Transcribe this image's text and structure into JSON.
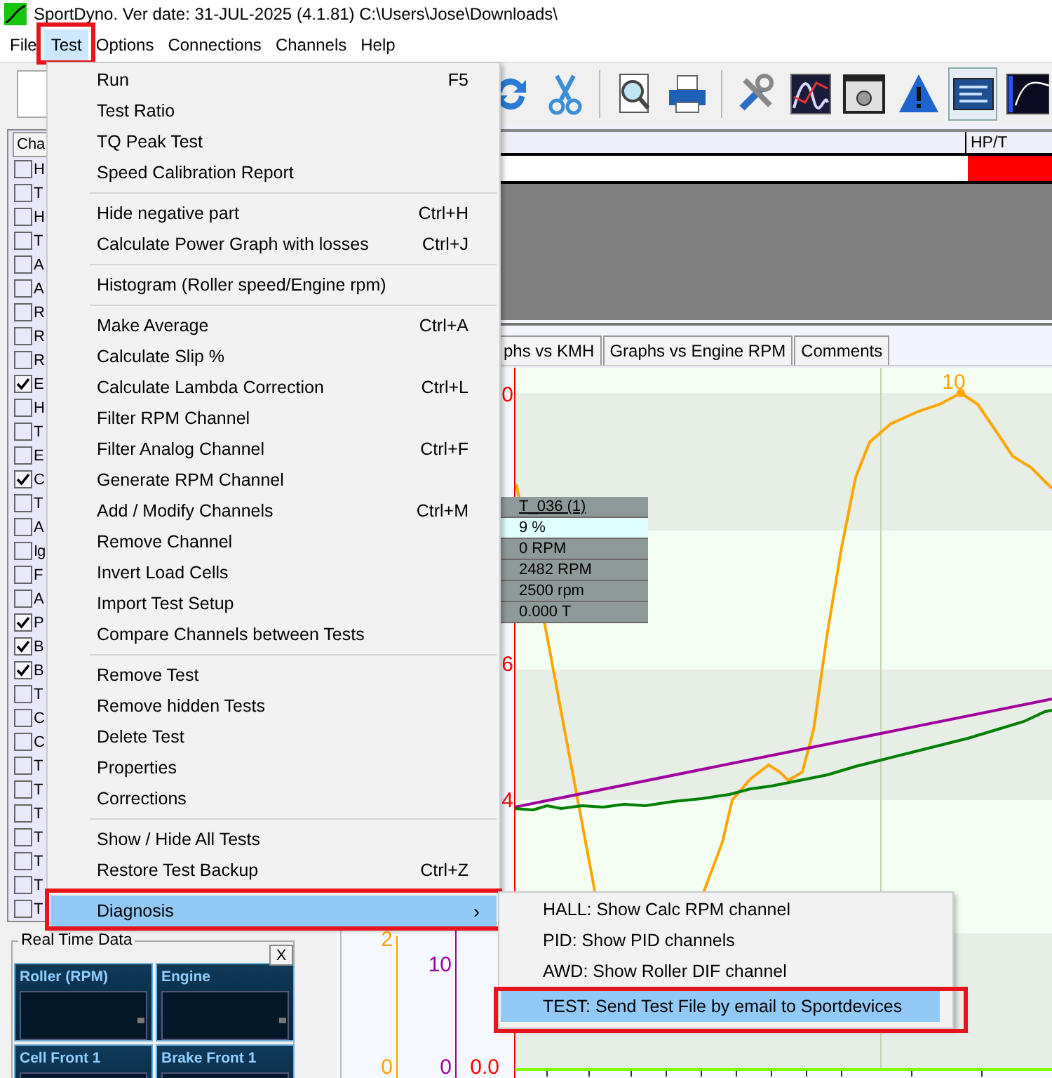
{
  "window": {
    "title": "SportDyno. Ver date: 31-JUL-2025 (4.1.81)  C:\\Users\\Jose\\Downloads\\"
  },
  "menubar": [
    {
      "label": "File",
      "selected": false,
      "highlighted": false
    },
    {
      "label": "Test",
      "selected": true,
      "highlighted": true
    },
    {
      "label": "Options",
      "selected": false,
      "highlighted": false
    },
    {
      "label": "Connections",
      "selected": false,
      "highlighted": false
    },
    {
      "label": "Channels",
      "selected": false,
      "highlighted": false
    },
    {
      "label": "Help",
      "selected": false,
      "highlighted": false
    }
  ],
  "toolbar_buttons": [
    {
      "pressed": false
    },
    {
      "pressed": false
    },
    {
      "pressed": false
    },
    {
      "pressed": false
    },
    {
      "pressed": false
    },
    {
      "pressed": false
    },
    {
      "pressed": false
    },
    {
      "pressed": false
    },
    {
      "pressed": true
    },
    {
      "pressed": false
    }
  ],
  "channel_list": {
    "header": "Cha",
    "rows": [
      {
        "label": "H",
        "checked": false
      },
      {
        "label": "T",
        "checked": false
      },
      {
        "label": "H",
        "checked": false
      },
      {
        "label": "T",
        "checked": false
      },
      {
        "label": "A",
        "checked": false
      },
      {
        "label": "A",
        "checked": false
      },
      {
        "label": "R",
        "checked": false
      },
      {
        "label": "R",
        "checked": false
      },
      {
        "label": "R",
        "checked": false
      },
      {
        "label": "E",
        "checked": true
      },
      {
        "label": "H",
        "checked": false
      },
      {
        "label": "T",
        "checked": false
      },
      {
        "label": "E",
        "checked": false
      },
      {
        "label": "C",
        "checked": true
      },
      {
        "label": "T",
        "checked": false
      },
      {
        "label": "A",
        "checked": false
      },
      {
        "label": "Ig",
        "checked": false
      },
      {
        "label": "F",
        "checked": false
      },
      {
        "label": "A",
        "checked": false
      },
      {
        "label": "P",
        "checked": true
      },
      {
        "label": "B",
        "checked": true
      },
      {
        "label": "B",
        "checked": true
      },
      {
        "label": "T",
        "checked": false
      },
      {
        "label": "C",
        "checked": false
      },
      {
        "label": "C",
        "checked": false
      },
      {
        "label": "T",
        "checked": false
      },
      {
        "label": "T",
        "checked": false
      },
      {
        "label": "T",
        "checked": false
      },
      {
        "label": "T",
        "checked": false
      },
      {
        "label": "T",
        "checked": false
      },
      {
        "label": "T",
        "checked": false
      },
      {
        "label": "T",
        "checked": false
      }
    ]
  },
  "real_time_data": {
    "title": "Real Time Data",
    "close": "X",
    "gauges": [
      {
        "label": "Roller (RPM)"
      },
      {
        "label": "Engine"
      },
      {
        "label": "Cell Front 1"
      },
      {
        "label": "Brake Front 1"
      }
    ]
  },
  "results_table": {
    "columns": [
      {
        "header": "HP/T",
        "color": "#ff0000"
      }
    ]
  },
  "tabs": [
    {
      "label": "phs vs KMH"
    },
    {
      "label": "Graphs vs Engine RPM"
    },
    {
      "label": "Comments"
    }
  ],
  "graph": {
    "axes": [
      {
        "color": "#ffa000",
        "labels": [
          "2",
          "0"
        ]
      },
      {
        "color": "#a000a0",
        "labels": [
          "10",
          "0"
        ]
      },
      {
        "color": "#ff0000",
        "labels": [
          "0",
          "6",
          "4",
          "0.0"
        ]
      }
    ],
    "curves": [
      {
        "color": "#ffa500"
      },
      {
        "color": "#a000a0"
      },
      {
        "color": "#008000"
      }
    ],
    "peak_label": "10",
    "cursor_box": {
      "title": "T_036 (1)",
      "rows": [
        {
          "text": "9 %",
          "selected": true
        },
        {
          "text": "0 RPM",
          "selected": false
        },
        {
          "text": "2482 RPM",
          "selected": false
        },
        {
          "text": "2500 rpm",
          "selected": false
        },
        {
          "text": "0.000 T",
          "selected": false
        }
      ]
    }
  },
  "test_menu": [
    {
      "kind": "item",
      "label": "Run",
      "shortcut": "F5"
    },
    {
      "kind": "item",
      "label": "Test Ratio"
    },
    {
      "kind": "item",
      "label": "TQ Peak Test"
    },
    {
      "kind": "item",
      "label": "Speed Calibration Report"
    },
    {
      "kind": "separator"
    },
    {
      "kind": "item",
      "label": "Hide negative part",
      "shortcut": "Ctrl+H"
    },
    {
      "kind": "item",
      "label": "Calculate Power Graph with losses",
      "shortcut": "Ctrl+J"
    },
    {
      "kind": "separator"
    },
    {
      "kind": "item",
      "label": "Histogram (Roller speed/Engine rpm)"
    },
    {
      "kind": "separator"
    },
    {
      "kind": "item",
      "label": "Make Average",
      "shortcut": "Ctrl+A"
    },
    {
      "kind": "item",
      "label": "Calculate Slip %"
    },
    {
      "kind": "item",
      "label": "Calculate Lambda Correction",
      "shortcut": "Ctrl+L"
    },
    {
      "kind": "item",
      "label": "Filter RPM Channel"
    },
    {
      "kind": "item",
      "label": "Filter Analog Channel",
      "shortcut": "Ctrl+F"
    },
    {
      "kind": "item",
      "label": "Generate RPM Channel"
    },
    {
      "kind": "item",
      "label": "Add / Modify Channels",
      "shortcut": "Ctrl+M"
    },
    {
      "kind": "item",
      "label": "Remove Channel"
    },
    {
      "kind": "item",
      "label": "Invert Load Cells"
    },
    {
      "kind": "item",
      "label": "Import Test Setup"
    },
    {
      "kind": "item",
      "label": "Compare Channels between Tests"
    },
    {
      "kind": "separator"
    },
    {
      "kind": "item",
      "label": "Remove Test"
    },
    {
      "kind": "item",
      "label": "Remove hidden Tests"
    },
    {
      "kind": "item",
      "label": "Delete Test"
    },
    {
      "kind": "item",
      "label": "Properties"
    },
    {
      "kind": "item",
      "label": "Corrections"
    },
    {
      "kind": "separator"
    },
    {
      "kind": "item",
      "label": "Show / Hide All Tests"
    },
    {
      "kind": "item",
      "label": "Restore Test Backup",
      "shortcut": "Ctrl+Z"
    },
    {
      "kind": "separator"
    },
    {
      "kind": "submenu",
      "label": "Diagnosis",
      "arrow": "›",
      "selected": true,
      "highlighted": true
    }
  ],
  "diagnosis_submenu": [
    {
      "label": "HALL: Show Calc RPM channel",
      "selected": false,
      "highlighted": false
    },
    {
      "label": "PID: Show PID channels",
      "selected": false,
      "highlighted": false
    },
    {
      "label": "AWD: Show Roller DIF channel",
      "selected": false,
      "highlighted": false
    },
    {
      "label": "TEST: Send Test File by email to Sportdevices",
      "selected": true,
      "highlighted": true
    }
  ]
}
